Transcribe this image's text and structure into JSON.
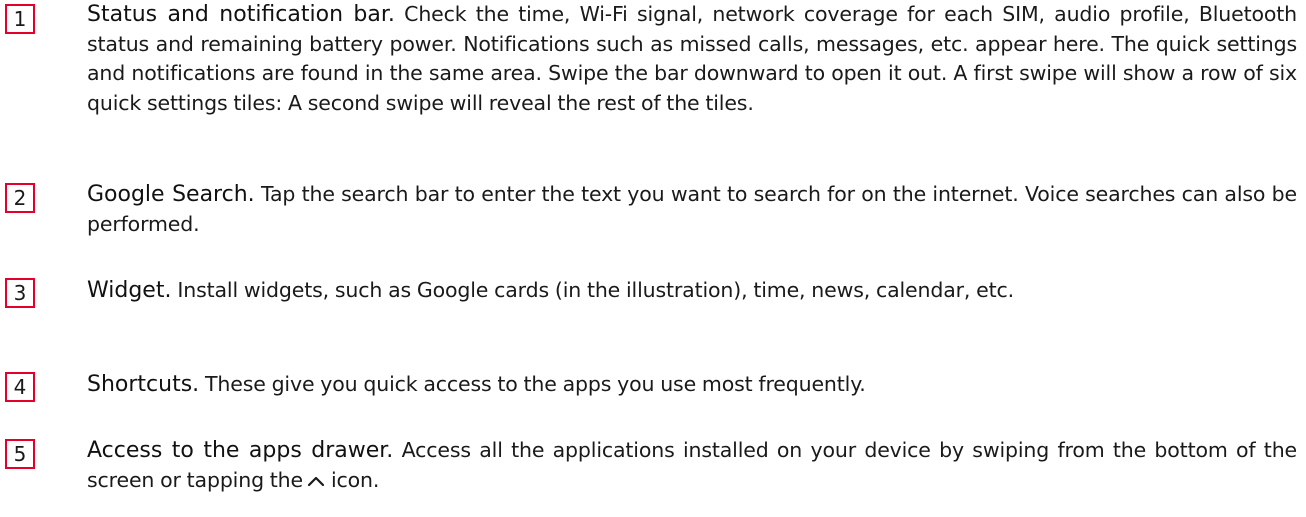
{
  "items": [
    {
      "number": "1",
      "title": "Status and notification bar.",
      "body": " Check the time, Wi-Fi signal, network coverage for each SIM, audio profile, Bluetooth status and remaining battery power. Notifications such as missed calls, messages, etc. appear here. The quick settings and notifications are found in the same area. Swipe the bar downward to open it out. A first swipe will show a row of six quick settings tiles: A second swipe will reveal the rest of the tiles."
    },
    {
      "number": "2",
      "title": "Google Search.",
      "body": " Tap the search bar to enter the text you want to search for on the internet. Voice searches can also be performed."
    },
    {
      "number": "3",
      "title": "Widget.",
      "body": " Install widgets, such as Google cards (in the illustration), time, news, calendar, etc."
    },
    {
      "number": "4",
      "title": "Shortcuts.",
      "body": " These give you quick access to the apps you use most frequently."
    },
    {
      "number": "5",
      "title": "Access to the apps drawer.",
      "body": " Access all the applications installed on your device by swiping from the bottom of the screen or tapping the",
      "body_after_icon": "icon.",
      "icon": "chevron-up-icon"
    }
  ],
  "colors": {
    "accent": "#e4002b",
    "text": "#1a1a1a"
  }
}
